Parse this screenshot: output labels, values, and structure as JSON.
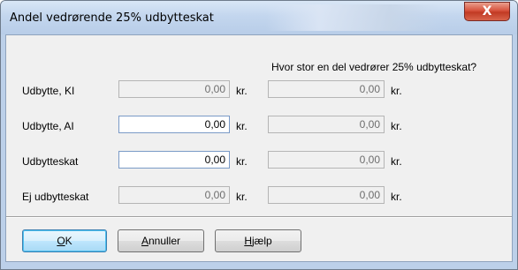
{
  "window": {
    "title": "Andel vedrørende 25% udbytteskat",
    "close_symbol": "X"
  },
  "header": "Hvor stor en del vedrører 25% udbytteskat?",
  "unit": "kr.",
  "rows": [
    {
      "label": "Udbytte, KI",
      "value1": "0,00",
      "value2": "0,00"
    },
    {
      "label": "Udbytte, AI",
      "value1": "0,00",
      "value2": "0,00"
    },
    {
      "label": "Udbytteskat",
      "value1": "0,00",
      "value2": "0,00"
    },
    {
      "label": "Ej udbytteskat",
      "value1": "0,00",
      "value2": "0,00"
    }
  ],
  "buttons": {
    "ok": {
      "accel": "O",
      "rest": "K"
    },
    "cancel": {
      "accel": "A",
      "rest": "nnuller"
    },
    "help": {
      "accel": "H",
      "rest": "jælp"
    }
  }
}
